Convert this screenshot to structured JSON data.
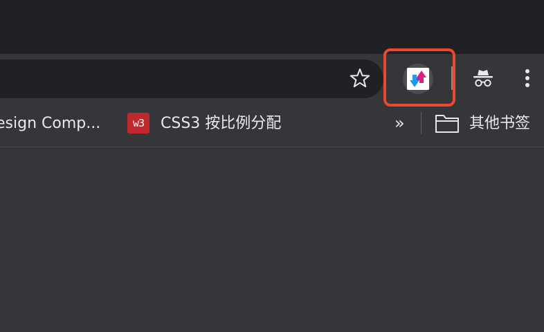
{
  "bookmarks_bar": {
    "items": [
      {
        "label": "esign Comp..."
      },
      {
        "favicon_text": "w3",
        "label": "CSS3 按比例分配"
      }
    ],
    "overflow_label": "»",
    "other_bookmarks_label": "其他书签"
  },
  "toolbar": {
    "icons": [
      "bookmark-star-icon",
      "extension-icon",
      "incognito-icon",
      "kebab-menu-icon"
    ]
  },
  "colors": {
    "highlight": "#f0462d",
    "toolbar_bg": "#35363a",
    "tabstrip_bg": "#202124",
    "omnibox_bg": "#202124",
    "w3_badge": "#c0282d",
    "extension_blue": "#1e9bf0",
    "extension_pink": "#e6197d"
  }
}
